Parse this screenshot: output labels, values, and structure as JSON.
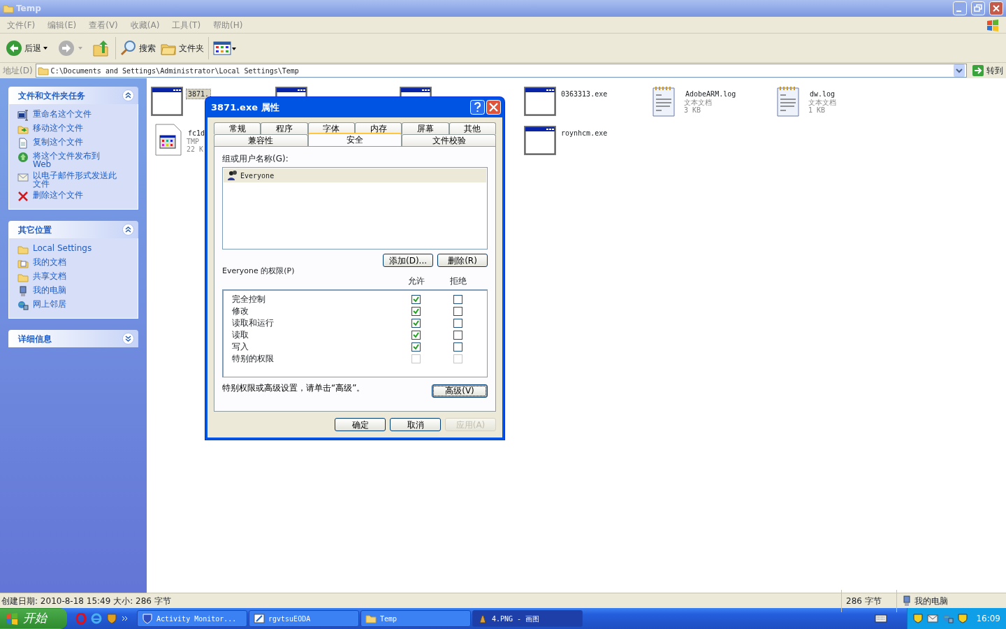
{
  "window": {
    "title": "Temp"
  },
  "menu": [
    "文件(F)",
    "编辑(E)",
    "查看(V)",
    "收藏(A)",
    "工具(T)",
    "帮助(H)"
  ],
  "toolbar": {
    "back": "后退",
    "search": "搜索",
    "folders": "文件夹"
  },
  "address": {
    "label": "地址(D)",
    "value": "C:\\Documents and Settings\\Administrator\\Local Settings\\Temp",
    "go": "转到"
  },
  "sidebar": [
    {
      "title": "文件和文件夹任务",
      "expanded": true,
      "items": [
        {
          "label": "重命名这个文件",
          "kind": "rename"
        },
        {
          "label": "移动这个文件",
          "kind": "move"
        },
        {
          "label": "复制这个文件",
          "kind": "copy"
        },
        {
          "label": "将这个文件发布到 Web",
          "kind": "web"
        },
        {
          "label": "以电子邮件形式发送此文件",
          "kind": "email"
        },
        {
          "label": "删除这个文件",
          "kind": "delete"
        }
      ]
    },
    {
      "title": "其它位置",
      "expanded": true,
      "items": [
        {
          "label": "Local Settings",
          "kind": "folder"
        },
        {
          "label": "我的文档",
          "kind": "documents"
        },
        {
          "label": "共享文档",
          "kind": "folder"
        },
        {
          "label": "我的电脑",
          "kind": "computer"
        },
        {
          "label": "网上邻居",
          "kind": "network"
        }
      ]
    },
    {
      "title": "详细信息",
      "expanded": false
    }
  ],
  "tile_columns": [
    [
      {
        "kind": "exe",
        "name": "3871.",
        "selected": true
      },
      {
        "kind": "tmp",
        "name": "fc1d",
        "type": "TMP",
        "size": "22 K",
        "selected": false
      }
    ],
    [
      {
        "kind": "exe"
      }
    ],
    [
      {
        "kind": "exe"
      }
    ],
    [
      {
        "kind": "exe",
        "name": "0363313.exe",
        "selected": false
      },
      {
        "kind": "exe",
        "name": "roynhcm.exe",
        "selected": false
      }
    ],
    [
      {
        "kind": "log",
        "name": "AdobeARM.log",
        "type": "文本文档",
        "size": "3 KB",
        "selected": false
      }
    ],
    [
      {
        "kind": "log",
        "name": "dw.log",
        "type": "文本文档",
        "size": "1 KB",
        "selected": false
      }
    ]
  ],
  "dialog": {
    "title": "3871.exe 属性",
    "tab_rows": [
      [
        {
          "label": "常规",
          "selected": false
        },
        {
          "label": "程序",
          "selected": false
        },
        {
          "label": "字体",
          "selected": false
        },
        {
          "label": "内存",
          "selected": false
        },
        {
          "label": "屏幕",
          "selected": false
        },
        {
          "label": "其他",
          "selected": false
        }
      ],
      [
        {
          "label": "兼容性",
          "selected": false
        },
        {
          "label": "安全",
          "selected": true
        },
        {
          "label": "文件校验",
          "selected": false
        }
      ]
    ],
    "users_label": "组或用户名称(G):",
    "users": [
      {
        "name": "Everyone",
        "selected": true
      }
    ],
    "add": "添加(D)...",
    "remove": "删除(R)",
    "permissions_label": "Everyone 的权限(P)",
    "columns": [
      "允许",
      "拒绝"
    ],
    "permissions": [
      {
        "name": "完全控制",
        "allow": true,
        "deny": false,
        "disabled": false
      },
      {
        "name": "修改",
        "allow": true,
        "deny": false,
        "disabled": false
      },
      {
        "name": "读取和运行",
        "allow": true,
        "deny": false,
        "disabled": false
      },
      {
        "name": "读取",
        "allow": true,
        "deny": false,
        "disabled": false
      },
      {
        "name": "写入",
        "allow": true,
        "deny": false,
        "disabled": false
      },
      {
        "name": "特别的权限",
        "allow": false,
        "deny": false,
        "disabled": true
      }
    ],
    "note": "特别权限或高级设置，请单击“高级”。",
    "advanced": "高级(V)",
    "buttons": [
      {
        "label": "确定",
        "disabled": false
      },
      {
        "label": "取消",
        "disabled": false
      },
      {
        "label": "应用(A)",
        "disabled": true
      }
    ]
  },
  "status_bar": {
    "details": "创建日期: 2010-8-18 15:49 大小: 286 字节",
    "size": "286 字节",
    "zone": "我的电脑"
  },
  "taskbar": {
    "start": "开始",
    "tasks": [
      {
        "label": "Activity Monitor...",
        "kind": "shield",
        "selected": false
      },
      {
        "label": "rgvtsuEODA",
        "kind": "paint",
        "selected": false
      },
      {
        "label": "Temp",
        "kind": "folder",
        "selected": false
      },
      {
        "label": "4.PNG - 画图",
        "kind": "brush",
        "selected": true
      }
    ],
    "clock": "16:09"
  }
}
